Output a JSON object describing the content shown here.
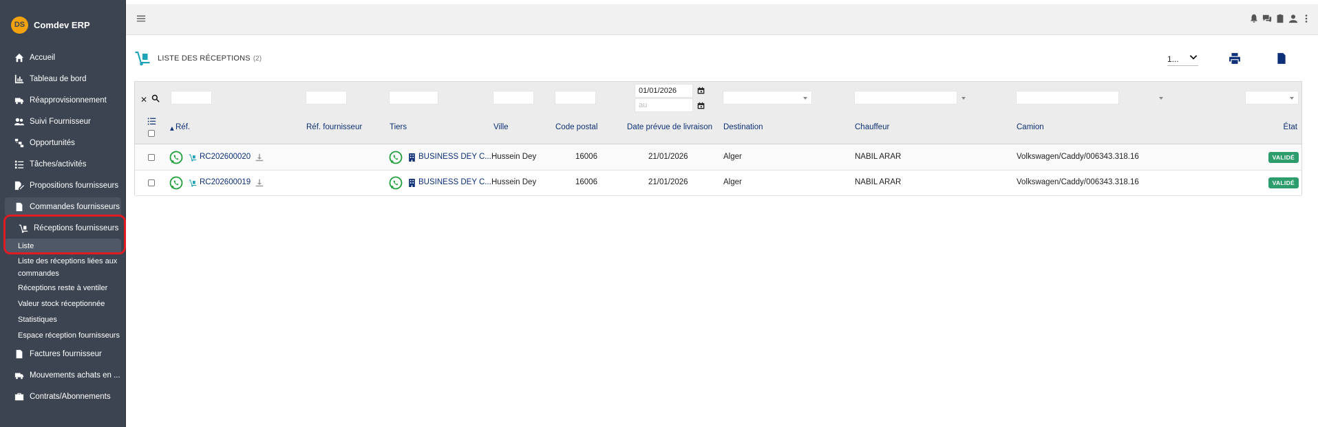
{
  "brand": {
    "name": "Comdev ERP",
    "logo_text": "DS"
  },
  "sidebar": {
    "items": [
      {
        "label": "Accueil",
        "icon": "home-icon"
      },
      {
        "label": "Tableau de bord",
        "icon": "chart-icon"
      },
      {
        "label": "Réapprovisionnement",
        "icon": "truck-icon"
      },
      {
        "label": "Suivi Fournisseur",
        "icon": "users-icon"
      },
      {
        "label": "Opportunités",
        "icon": "sitemap-icon"
      },
      {
        "label": "Tâches/activités",
        "icon": "tasks-icon"
      },
      {
        "label": "Propositions fournisseurs",
        "icon": "file-signature-icon"
      },
      {
        "label": "Commandes fournisseurs",
        "icon": "file-invoice-icon"
      },
      {
        "label": "Réceptions fournisseurs",
        "icon": "dolly-icon"
      }
    ],
    "sub_items": [
      {
        "label": "Liste"
      },
      {
        "label": "Liste des réceptions liées aux commandes"
      },
      {
        "label": "Réceptions reste à ventiler"
      },
      {
        "label": "Valeur stock réceptionnée"
      },
      {
        "label": "Statistiques"
      },
      {
        "label": "Espace réception fournisseurs"
      }
    ],
    "bottom_items": [
      {
        "label": "Factures fournisseur",
        "icon": "file-invoice-dollar-icon"
      },
      {
        "label": "Mouvements achats en ...",
        "icon": "truck-icon"
      },
      {
        "label": "Contrats/Abonnements",
        "icon": "suitcase-icon"
      }
    ]
  },
  "page": {
    "title": "LISTE DES RÉCEPTIONS",
    "count": "(2)",
    "per_page": "1...",
    "print_icon": "print-icon",
    "export_icon": "excel-icon"
  },
  "filters": {
    "date_from": "01/01/2026",
    "date_to_placeholder": "au"
  },
  "columns": {
    "ref": "Réf.",
    "ref_supplier": "Réf. fournisseur",
    "tiers": "Tiers",
    "ville": "Ville",
    "code_postal": "Code postal",
    "date_livraison": "Date prévue de livraison",
    "destination": "Destination",
    "chauffeur": "Chauffeur",
    "camion": "Camion",
    "etat": "État"
  },
  "rows": [
    {
      "ref": "RC202600020",
      "tiers": "BUSINESS DEY C...",
      "ville": "Hussein Dey",
      "code_postal": "16006",
      "date_livraison": "21/01/2026",
      "destination": "Alger",
      "chauffeur": "NABIL ARAR",
      "camion": "Volkswagen/Caddy/006343.318.16",
      "etat": "VALIDÉ"
    },
    {
      "ref": "RC202600019",
      "tiers": "BUSINESS DEY C...",
      "ville": "Hussein Dey",
      "code_postal": "16006",
      "date_livraison": "21/01/2026",
      "destination": "Alger",
      "chauffeur": "NABIL ARAR",
      "camion": "Volkswagen/Caddy/006343.318.16",
      "etat": "VALIDÉ"
    }
  ],
  "colors": {
    "sidebar_bg": "#3c4451",
    "link": "#0c2f77",
    "badge": "#2e9d6e",
    "accent": "#1fa3b8",
    "highlight": "#e01b24"
  }
}
